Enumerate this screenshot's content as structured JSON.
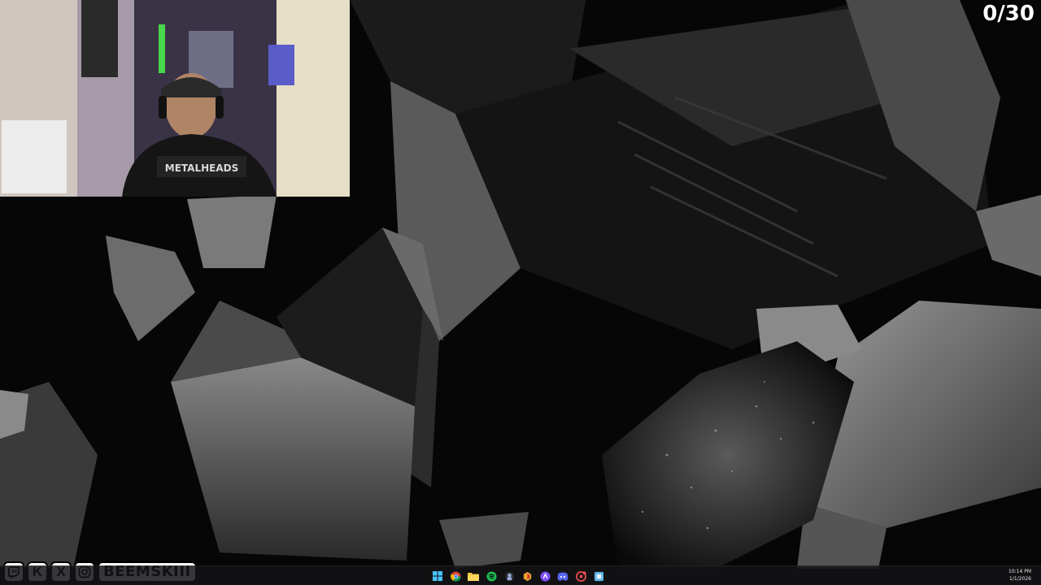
{
  "overlay": {
    "counter": "0/30",
    "handle": "BEEMSKIII",
    "socials": [
      {
        "name": "twitch-icon",
        "glyph": ""
      },
      {
        "name": "kick-icon",
        "glyph": "K"
      },
      {
        "name": "x-icon",
        "glyph": "X"
      },
      {
        "name": "instagram-icon",
        "glyph": ""
      }
    ]
  },
  "webcam": {
    "shirt_text": "METALHEADS"
  },
  "taskbar": {
    "icons": [
      "windows-start-icon",
      "chrome-icon",
      "file-explorer-icon",
      "spotify-icon",
      "app-icon",
      "app-icon-2",
      "app-icon-3",
      "discord-icon",
      "app-icon-4",
      "app-icon-5"
    ],
    "time": "10:14 PM",
    "date": "1/1/2026"
  }
}
